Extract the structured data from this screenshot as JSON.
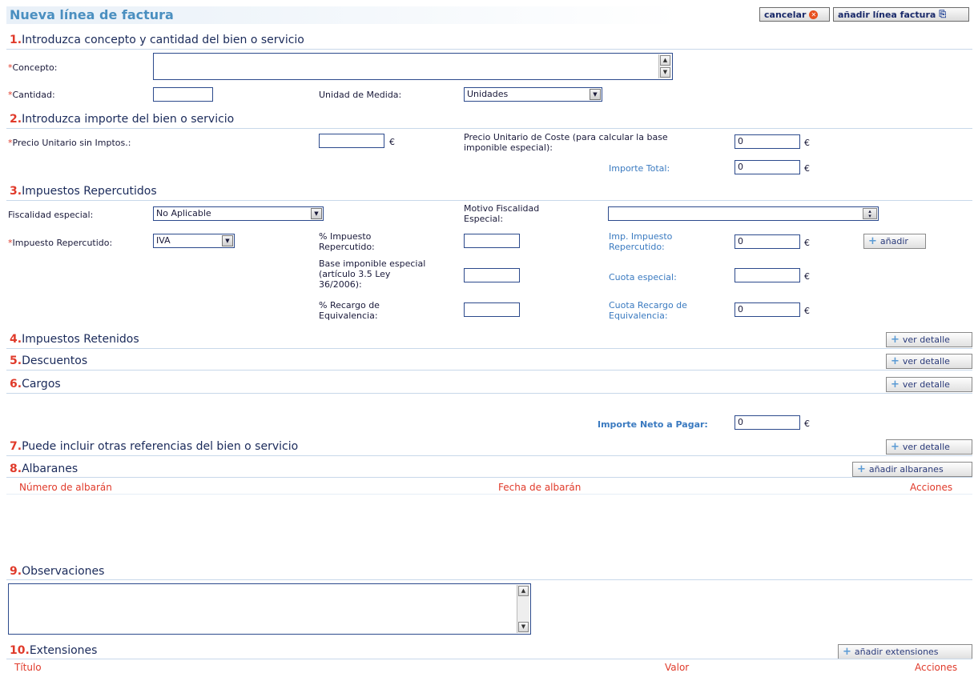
{
  "header": {
    "title": "Nueva línea de factura",
    "cancel_label": "cancelar",
    "add_line_label": "añadir línea factura"
  },
  "s1": {
    "num": "1.",
    "title": "Introduzca concepto y cantidad del bien o servicio",
    "concepto_label": "Concepto:",
    "cantidad_label": "Cantidad:",
    "unidad_label": "Unidad de Medida:",
    "unidad_value": "Unidades"
  },
  "s2": {
    "num": "2.",
    "title": "Introduzca importe del bien o servicio",
    "precio_label": "Precio Unitario sin Imptos.:",
    "precio_coste_label_1": "Precio Unitario de Coste (para calcular la base",
    "precio_coste_label_2": "imponible especial):",
    "precio_coste_value": "0",
    "importe_total_label": "Importe Total:",
    "importe_total_value": "0",
    "currency": "€"
  },
  "s3": {
    "num": "3.",
    "title": "Impuestos Repercutidos",
    "fiscalidad_label": "Fiscalidad especial:",
    "fiscalidad_value": "No Aplicable",
    "motivo_label_1": "Motivo Fiscalidad",
    "motivo_label_2": "Especial:",
    "impuesto_label": "Impuesto Repercutido:",
    "impuesto_value": "IVA",
    "pct_impuesto_label_1": "% Impuesto",
    "pct_impuesto_label_2": "Repercutido:",
    "imp_impuesto_label_1": "Imp. Impuesto",
    "imp_impuesto_label_2": "Repercutido:",
    "imp_impuesto_value": "0",
    "add_label": "añadir",
    "base_label_1": "Base imponible especial",
    "base_label_2": "(artículo 3.5 Ley",
    "base_label_3": "36/2006):",
    "cuota_especial_label": "Cuota especial:",
    "recargo_label_1": "% Recargo de",
    "recargo_label_2": "Equivalencia:",
    "cuota_recargo_label_1": "Cuota Recargo de",
    "cuota_recargo_label_2": "Equivalencia:",
    "cuota_recargo_value": "0"
  },
  "s4": {
    "num": "4.",
    "title": "Impuestos Retenidos",
    "btn": "ver detalle"
  },
  "s5": {
    "num": "5.",
    "title": "Descuentos",
    "btn": "ver detalle"
  },
  "s6": {
    "num": "6.",
    "title": "Cargos",
    "btn": "ver detalle"
  },
  "neto": {
    "label": "Importe Neto a Pagar:",
    "value": "0"
  },
  "s7": {
    "num": "7.",
    "title": "Puede incluir otras referencias del bien o servicio",
    "btn": "ver detalle"
  },
  "s8": {
    "num": "8.",
    "title": "Albaranes",
    "btn": "añadir albaranes",
    "columns": [
      "Número de albarán",
      "Fecha de albarán",
      "Acciones"
    ]
  },
  "s9": {
    "num": "9.",
    "title": "Observaciones"
  },
  "s10": {
    "num": "10.",
    "title": "Extensiones",
    "btn": "añadir extensiones",
    "columns": [
      "Título",
      "Valor",
      "Acciones"
    ]
  },
  "required_mark": "*",
  "colors": {
    "accent": "#4a8fc0",
    "required": "#e03a2a",
    "section_line": "#c8d8ea",
    "label_blue": "#3a7ac0"
  }
}
